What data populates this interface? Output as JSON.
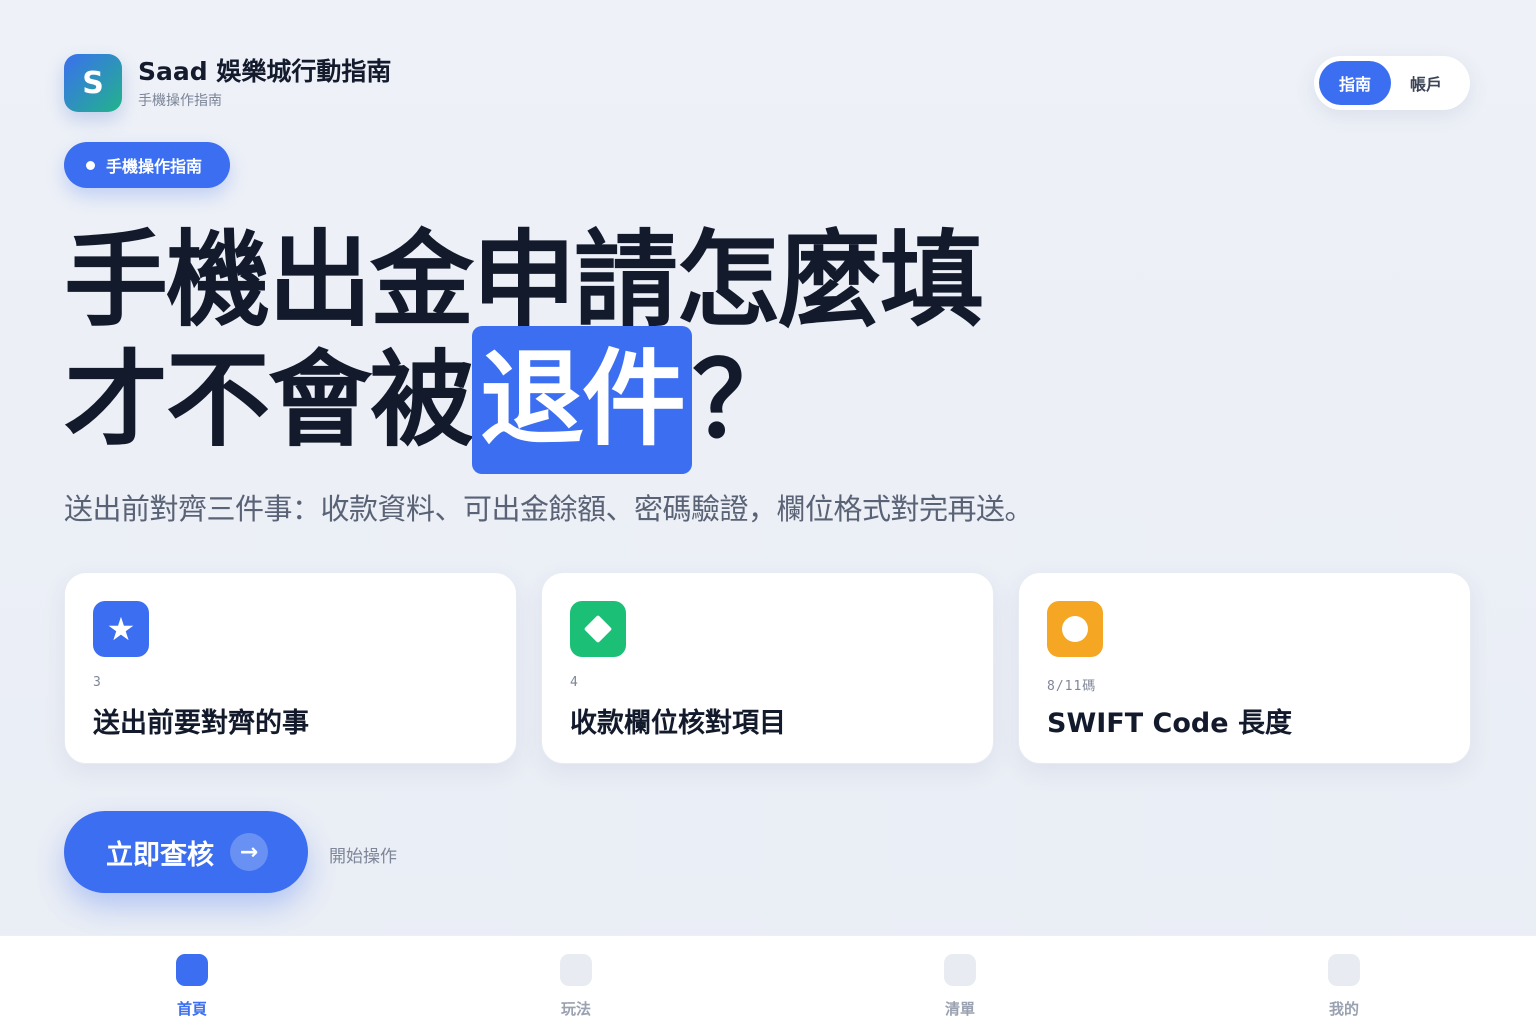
{
  "brand": {
    "logo_letter": "S",
    "title": "Saad 娛樂城行動指南",
    "subtitle": "手機操作指南"
  },
  "segmented": {
    "active_label": "指南",
    "other_label": "帳戶"
  },
  "tag": {
    "label": "手機操作指南"
  },
  "headline": {
    "line1": "手機出金申請怎麼填",
    "line2_pre": "才不會被",
    "line2_highlight": "退件",
    "line2_post": "？"
  },
  "subtitle": "送出前對齊三件事：收款資料、可出金餘額、密碼驗證，欄位格式對完再送。",
  "cards": [
    {
      "icon": "star-icon",
      "meta": "3",
      "title": "送出前要對齊的事",
      "color": "#3b6ef0"
    },
    {
      "icon": "diamond-icon",
      "meta": "4",
      "title": "收款欄位核對項目",
      "color": "#1cbf76"
    },
    {
      "icon": "circle-icon",
      "meta": "8/11碼",
      "title": "SWIFT Code 長度",
      "color": "#f5a623"
    }
  ],
  "cta": {
    "label": "立即查核",
    "arrow": "→",
    "hint": "開始操作"
  },
  "bottom_nav": [
    {
      "label": "首頁",
      "active": true
    },
    {
      "label": "玩法",
      "active": false
    },
    {
      "label": "清單",
      "active": false
    },
    {
      "label": "我的",
      "active": false
    }
  ],
  "colors": {
    "accent": "#3b6ef0",
    "green": "#1cbf76",
    "orange": "#f5a623",
    "text": "#131a2c"
  }
}
